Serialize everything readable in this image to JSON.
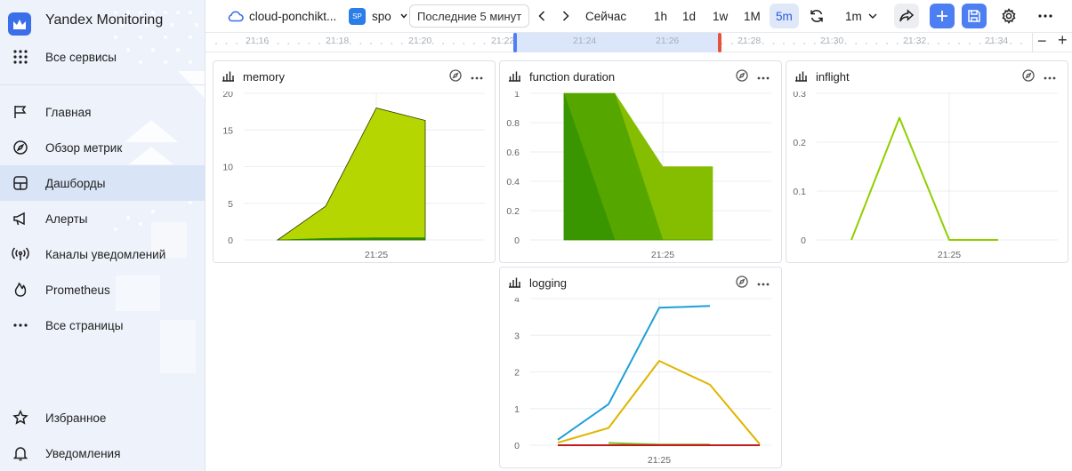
{
  "sidebar": {
    "brand": "Yandex Monitoring",
    "all_services": "Все сервисы",
    "items": [
      {
        "label": "Главная",
        "icon": "flag-icon"
      },
      {
        "label": "Обзор метрик",
        "icon": "compass-icon"
      },
      {
        "label": "Дашборды",
        "icon": "dashboard-icon",
        "active": true
      },
      {
        "label": "Алерты",
        "icon": "megaphone-icon"
      },
      {
        "label": "Каналы уведомлений",
        "icon": "broadcast-icon"
      },
      {
        "label": "Prometheus",
        "icon": "flame-icon"
      },
      {
        "label": "Все страницы",
        "icon": "more-horizontal-icon"
      }
    ],
    "bottom": [
      {
        "label": "Избранное",
        "icon": "star-icon"
      },
      {
        "label": "Уведомления",
        "icon": "bell-icon"
      }
    ]
  },
  "toolbar": {
    "cloud": "cloud-ponchikt...",
    "folder_badge": "SP",
    "folder": "spo",
    "range": "Последние 5 минут",
    "now": "Сейчас",
    "zooms": [
      "1h",
      "1d",
      "1w",
      "1M",
      "5m"
    ],
    "selected_zoom": "5m",
    "refresh_interval": "1m"
  },
  "timeline": {
    "ticks": [
      "21:16",
      "21:18",
      "21:20",
      "21:22",
      "21:24",
      "21:26",
      "21:28",
      "21:30",
      "21:32",
      "21:34"
    ],
    "minus": "−",
    "plus": "+"
  },
  "colors": {
    "accent": "#4d7ef2",
    "selected_range": "#dbe6fb",
    "handle_left": "#4d7ef2",
    "handle_right": "#e5533d"
  },
  "chart_data": [
    {
      "name": "memory",
      "type": "area",
      "title": "memory",
      "x_tick": "21:25",
      "ylim": [
        0,
        20
      ],
      "yticks": [
        "20",
        "15",
        "10",
        "5",
        "0"
      ],
      "ytick_values": [
        20,
        15,
        10,
        5,
        0
      ],
      "x_points": [
        0,
        1,
        2,
        3
      ],
      "series": [
        {
          "color": "#b5d600",
          "values": [
            0,
            4.6,
            18.0,
            16.3
          ]
        },
        {
          "color": "#2e8b00",
          "values": [
            0,
            0.2,
            0.3,
            0.3
          ]
        }
      ]
    },
    {
      "name": "function-duration",
      "type": "area",
      "title": "function duration",
      "x_tick": "21:25",
      "ylim": [
        0,
        1
      ],
      "yticks": [
        "1",
        "0.8",
        "0.6",
        "0.4",
        "0.2",
        "0"
      ],
      "ytick_values": [
        1,
        0.8,
        0.6,
        0.4,
        0.2,
        0
      ],
      "x_points": [
        0,
        1,
        2,
        3
      ],
      "series": [
        {
          "color": "#85bd00",
          "values": [
            1,
            1,
            0.5,
            0.5
          ]
        },
        {
          "color": "#56a600",
          "values": [
            1,
            1,
            0,
            0
          ]
        },
        {
          "color": "#3a9600",
          "values": [
            1,
            0,
            0,
            0
          ]
        }
      ]
    },
    {
      "name": "inflight",
      "type": "line",
      "title": "inflight",
      "x_tick": "21:25",
      "ylim": [
        0,
        0.3
      ],
      "yticks": [
        "0.3",
        "0.2",
        "0.1",
        "0"
      ],
      "ytick_values": [
        0.3,
        0.2,
        0.1,
        0
      ],
      "x_points": [
        0,
        1,
        2,
        3
      ],
      "series": [
        {
          "color": "#8fcf00",
          "values": [
            0,
            0.25,
            0,
            0
          ]
        }
      ]
    },
    {
      "name": "logging",
      "type": "line",
      "title": "logging",
      "x_tick": "21:25",
      "ylim": [
        0,
        4
      ],
      "yticks": [
        "4",
        "3",
        "2",
        "1",
        "0"
      ],
      "ytick_values": [
        4,
        3,
        2,
        1,
        0
      ],
      "x_points": [
        0,
        1,
        2,
        3,
        4
      ],
      "series": [
        {
          "color": "#1e9fd8",
          "values": [
            0.15,
            1.12,
            3.75,
            3.8,
            null
          ]
        },
        {
          "color": "#e0b400",
          "values": [
            0.07,
            0.47,
            2.3,
            1.65,
            0.03
          ]
        },
        {
          "color": "#7dbb2a",
          "values": [
            null,
            0.06,
            0.02,
            0.02,
            null
          ]
        },
        {
          "color": "#c11c1c",
          "values": [
            0,
            0,
            0,
            0,
            0
          ]
        }
      ]
    }
  ]
}
